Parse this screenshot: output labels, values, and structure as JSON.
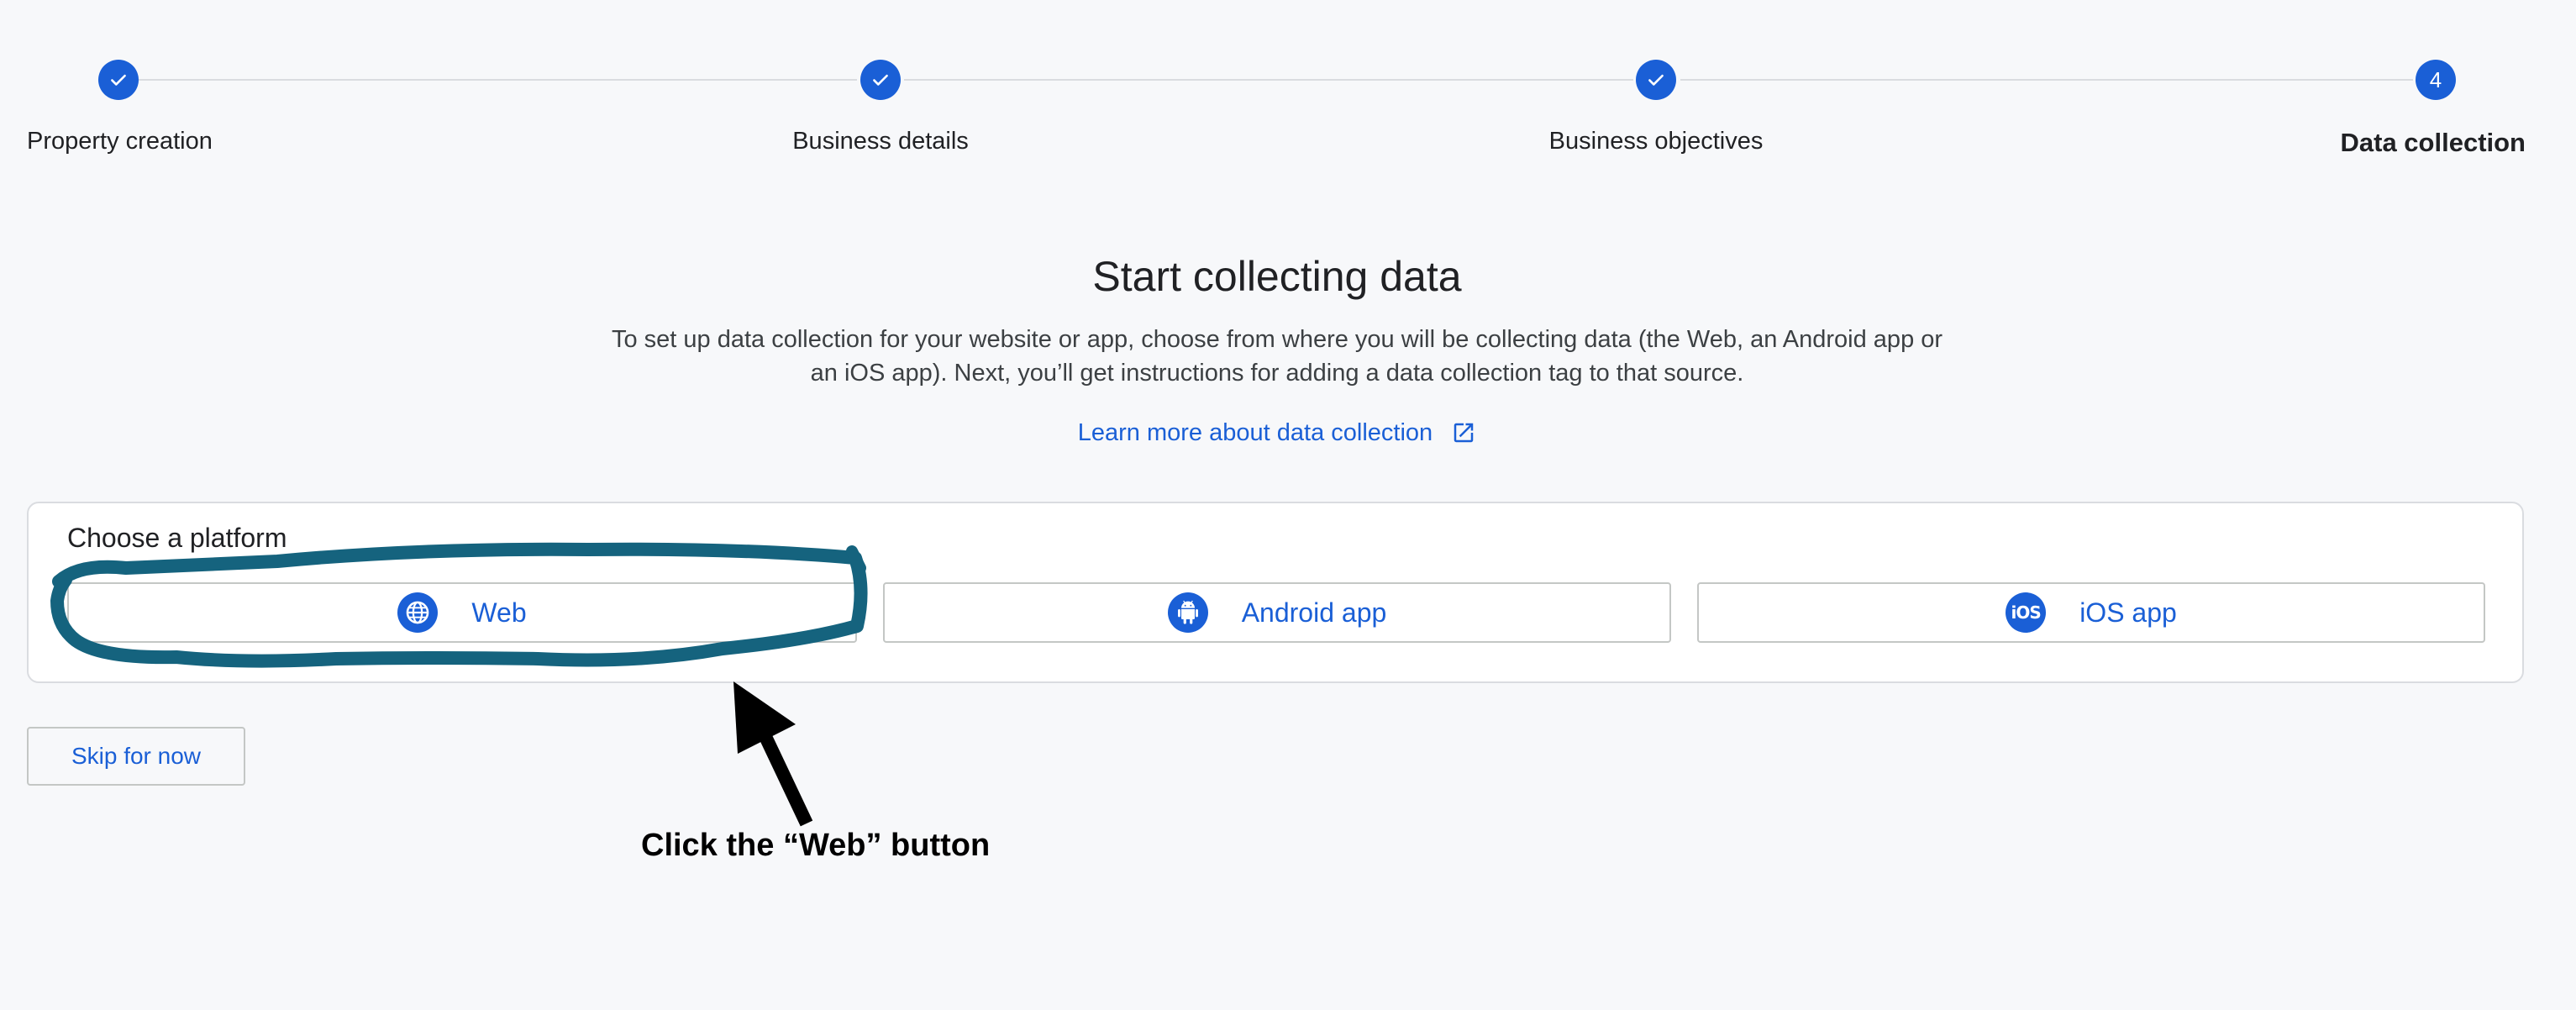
{
  "stepper": {
    "steps": [
      {
        "label": "Property creation",
        "state": "complete",
        "icon": "check-icon"
      },
      {
        "label": "Business details",
        "state": "complete",
        "icon": "check-icon"
      },
      {
        "label": "Business objectives",
        "state": "complete",
        "icon": "check-icon"
      },
      {
        "label": "Data collection",
        "state": "current",
        "number": "4"
      }
    ]
  },
  "main": {
    "title": "Start collecting data",
    "description": "To set up data collection for your website or app, choose from where you will be collecting data (the Web, an Android app or an iOS app). Next, you’ll get instructions for adding a data collection tag to that source.",
    "learn_more": {
      "label": "Learn more about data collection",
      "icon": "open-in-new-icon"
    }
  },
  "platform": {
    "heading": "Choose a platform",
    "options": [
      {
        "label": "Web",
        "icon": "globe-icon"
      },
      {
        "label": "Android app",
        "icon": "android-icon"
      },
      {
        "label": "iOS app",
        "icon": "ios-icon",
        "icon_text": "iOS"
      }
    ]
  },
  "skip": {
    "label": "Skip for now"
  },
  "annotation": {
    "caption": "Click the “Web” button",
    "highlight_color": "#15637e"
  },
  "colors": {
    "accent": "#1a5fd6",
    "background": "#f7f8fa",
    "border": "#dadce0"
  }
}
